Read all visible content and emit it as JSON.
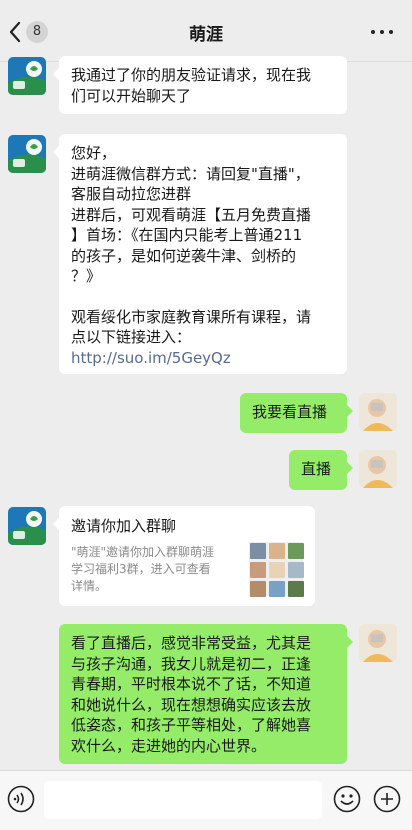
{
  "header": {
    "title": "萌涯",
    "unread_count": "8"
  },
  "messages": {
    "m1": {
      "lines": [
        "我通过了你的朋友验证请求，现在我",
        "们可以开始聊天了"
      ]
    },
    "m2": {
      "lines": [
        "您好，",
        "进萌涯微信群方式：请回复\"直播\"，",
        "客服自动拉您进群",
        "进群后，可观看萌涯【五月免费直播",
        "】首场：《在国内只能考上普通211",
        "的孩子，是如何逆袭牛津、剑桥的",
        "？》",
        "",
        "观看绥化市家庭教育课所有课程，请",
        "点以下链接进入："
      ],
      "link": "http://suo.im/5GeyQz"
    },
    "m3": {
      "text": "我要看直播"
    },
    "m4": {
      "text": "直播"
    },
    "m5": {
      "title": "邀请你加入群聊",
      "desc_lines": [
        "\"萌涯\"邀请你加入群聊萌涯",
        "学习福利3群，进入可查看",
        "详情。"
      ]
    },
    "m6": {
      "lines": [
        "看了直播后，感觉非常受益，尤其是",
        "与孩子沟通，我女儿就是初二，正逢",
        "青春期，平时根本说不了话，不知道",
        "和她说什么，现在想想确实应该去放",
        "低姿态，和孩子平等相处，了解她喜",
        "欢什么，走进她的内心世界。"
      ]
    }
  },
  "icons": {
    "back": "chevron-left-icon",
    "more": "more-icon",
    "voice": "voice-icon",
    "emoji": "emoji-icon",
    "plus": "plus-icon"
  },
  "colors": {
    "green_bubble": "#95ec69",
    "link": "#576b95",
    "background": "#ededed"
  }
}
